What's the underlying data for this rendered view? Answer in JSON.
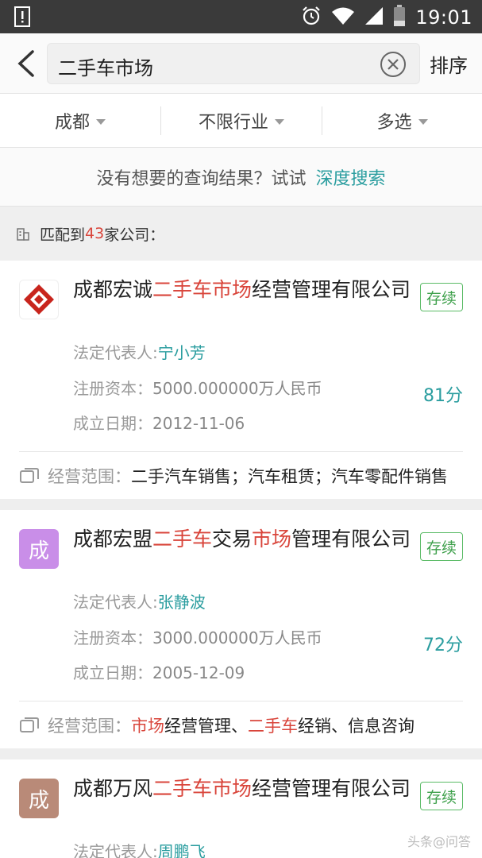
{
  "status_bar": {
    "time": "19:01",
    "icons": [
      "notification-icon",
      "alarm-icon",
      "wifi-icon",
      "signal-icon",
      "battery-icon"
    ]
  },
  "header": {
    "search_query": "二手车市场",
    "sort_label": "排序"
  },
  "filters": [
    {
      "label": "成都"
    },
    {
      "label": "不限行业"
    },
    {
      "label": "多选"
    }
  ],
  "hint": {
    "text": "没有想要的查询结果？试试",
    "link": "深度搜索"
  },
  "results_count": {
    "prefix": "匹配到",
    "count": "43",
    "suffix": "家公司："
  },
  "labels": {
    "rep": "法定代表人:",
    "capital": "注册资本：",
    "date": "成立日期：",
    "scope": "经营范围："
  },
  "companies": [
    {
      "name_parts": [
        {
          "text": "成都宏诚",
          "hl": false
        },
        {
          "text": "二手车市场",
          "hl": true
        },
        {
          "text": "经营管理有限公司",
          "hl": false
        }
      ],
      "status": "存续",
      "rep": "宁小芳",
      "capital": "5000.000000万人民币",
      "date": "2012-11-06",
      "score": "81分",
      "scope_parts": [
        {
          "text": "二手汽车销售；汽车租赁；汽车零配件销售",
          "hl": false
        }
      ],
      "logo_text": "",
      "logo_color": "#ffffff"
    },
    {
      "name_parts": [
        {
          "text": "成都宏盟",
          "hl": false
        },
        {
          "text": "二手车",
          "hl": true
        },
        {
          "text": "交易",
          "hl": false
        },
        {
          "text": "市场",
          "hl": true
        },
        {
          "text": "管理有限公司",
          "hl": false
        }
      ],
      "status": "存续",
      "rep": "张静波",
      "capital": "3000.000000万人民币",
      "date": "2005-12-09",
      "score": "72分",
      "scope_parts": [
        {
          "text": "市场",
          "hl": true
        },
        {
          "text": "经营管理、",
          "hl": false
        },
        {
          "text": "二手车",
          "hl": true
        },
        {
          "text": "经销、信息咨询",
          "hl": false
        }
      ],
      "logo_text": "成",
      "logo_color": "#c98ee8"
    },
    {
      "name_parts": [
        {
          "text": "成都万风",
          "hl": false
        },
        {
          "text": "二手车市场",
          "hl": true
        },
        {
          "text": "经营管理有限公司",
          "hl": false
        }
      ],
      "status": "存续",
      "rep": "周鹏飞",
      "logo_text": "成",
      "logo_color": "#b98a78"
    }
  ],
  "watermark": "头条@问答"
}
